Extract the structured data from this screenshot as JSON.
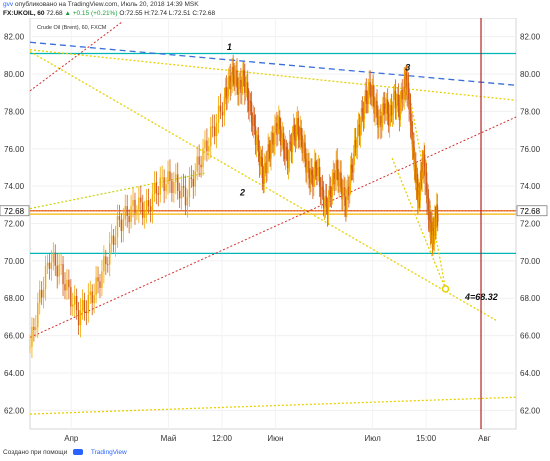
{
  "header": {
    "user": "gvv",
    "published_text": "опубликовано на TradingView.com, Июль 20, 2018 14:39 MSK",
    "symbol": "FX:UKOIL, 60",
    "price": "72.68",
    "change": "▲ +0.15 (+0.21%)",
    "ohlc": "O:72.55 H:72.74 L:72.51 C:72.68"
  },
  "footer": {
    "label": "Создано при помощи",
    "brand": "TradingView"
  },
  "chart_data": {
    "type": "candlestick",
    "title": "Crude Oil (Brent), 60, FXCM",
    "x_ticks": [
      "Апр",
      "Май",
      "12:00",
      "Июн",
      "Июл",
      "15:00",
      "Авг"
    ],
    "y_ticks": [
      62.0,
      64.0,
      66.0,
      68.0,
      70.0,
      72.0,
      74.0,
      76.0,
      78.0,
      80.0,
      82.0
    ],
    "ylim": [
      61.0,
      83.0
    ],
    "last_price_label": "72.68",
    "last_price": 72.68,
    "horizontal_levels": [
      {
        "value": 81.1,
        "color": "#00b5b5"
      },
      {
        "value": 70.4,
        "color": "#00b5b5"
      },
      {
        "value": 72.68,
        "color": "#e65100"
      },
      {
        "value": 72.5,
        "color": "#f5b400"
      }
    ],
    "wave_labels": [
      {
        "text": "1",
        "x": 0.405,
        "y": 81.3
      },
      {
        "text": "2",
        "x": 0.432,
        "y": 73.5
      },
      {
        "text": "3",
        "x": 0.772,
        "y": 80.2
      },
      {
        "text": "4=68.32",
        "x": 0.895,
        "y": 67.9
      }
    ],
    "target_point": {
      "x": 0.855,
      "y": 68.5
    },
    "series_close_points": [
      [
        0.0,
        65.4
      ],
      [
        0.02,
        68.0
      ],
      [
        0.04,
        70.1
      ],
      [
        0.06,
        69.6
      ],
      [
        0.08,
        68.3
      ],
      [
        0.1,
        67.1
      ],
      [
        0.12,
        67.8
      ],
      [
        0.14,
        68.8
      ],
      [
        0.16,
        70.3
      ],
      [
        0.18,
        71.9
      ],
      [
        0.2,
        72.5
      ],
      [
        0.22,
        73.0
      ],
      [
        0.24,
        72.7
      ],
      [
        0.26,
        73.9
      ],
      [
        0.28,
        74.3
      ],
      [
        0.3,
        74.1
      ],
      [
        0.32,
        73.4
      ],
      [
        0.34,
        74.8
      ],
      [
        0.36,
        76.0
      ],
      [
        0.38,
        77.2
      ],
      [
        0.4,
        78.6
      ],
      [
        0.41,
        79.6
      ],
      [
        0.42,
        80.0
      ],
      [
        0.43,
        79.2
      ],
      [
        0.44,
        79.8
      ],
      [
        0.45,
        78.5
      ],
      [
        0.46,
        77.3
      ],
      [
        0.47,
        75.9
      ],
      [
        0.48,
        74.5
      ],
      [
        0.49,
        75.7
      ],
      [
        0.5,
        76.5
      ],
      [
        0.51,
        77.4
      ],
      [
        0.52,
        76.3
      ],
      [
        0.53,
        75.4
      ],
      [
        0.54,
        76.6
      ],
      [
        0.55,
        77.2
      ],
      [
        0.56,
        76.3
      ],
      [
        0.57,
        75.0
      ],
      [
        0.58,
        74.3
      ],
      [
        0.59,
        75.1
      ],
      [
        0.6,
        73.6
      ],
      [
        0.61,
        72.8
      ],
      [
        0.62,
        73.9
      ],
      [
        0.63,
        74.9
      ],
      [
        0.64,
        74.0
      ],
      [
        0.65,
        73.1
      ],
      [
        0.66,
        74.6
      ],
      [
        0.67,
        76.3
      ],
      [
        0.68,
        77.4
      ],
      [
        0.69,
        78.6
      ],
      [
        0.7,
        79.3
      ],
      [
        0.71,
        78.2
      ],
      [
        0.72,
        77.3
      ],
      [
        0.73,
        78.4
      ],
      [
        0.74,
        77.6
      ],
      [
        0.75,
        78.8
      ],
      [
        0.76,
        78.1
      ],
      [
        0.77,
        79.4
      ],
      [
        0.775,
        79.6
      ],
      [
        0.78,
        78.6
      ],
      [
        0.785,
        77.0
      ],
      [
        0.79,
        75.6
      ],
      [
        0.795,
        74.3
      ],
      [
        0.8,
        73.2
      ],
      [
        0.805,
        74.6
      ],
      [
        0.81,
        75.4
      ],
      [
        0.815,
        74.2
      ],
      [
        0.82,
        72.6
      ],
      [
        0.825,
        71.6
      ],
      [
        0.83,
        71.3
      ],
      [
        0.835,
        72.3
      ],
      [
        0.84,
        72.7
      ]
    ]
  }
}
